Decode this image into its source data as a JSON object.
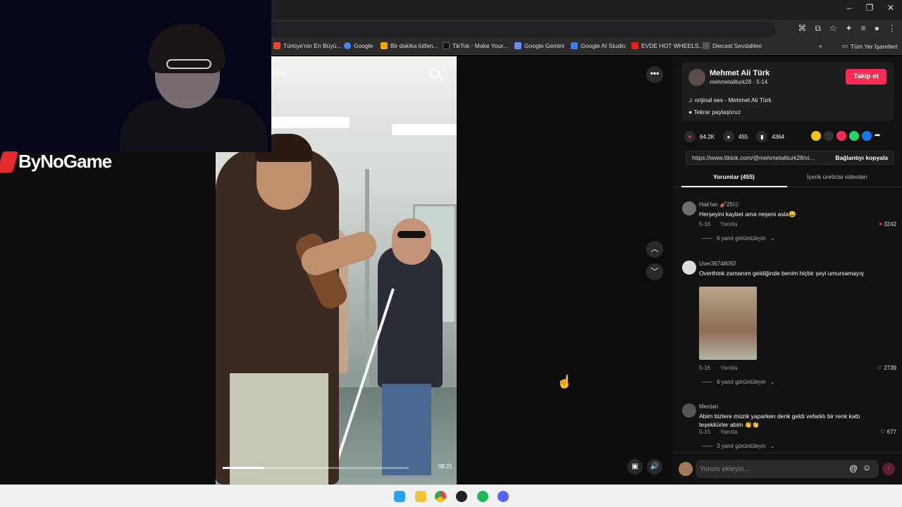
{
  "window": {
    "minimize": "–",
    "maximize": "❐",
    "close": "✕"
  },
  "bookmarks": [
    {
      "label": "Türkiye'nin En Büyü...",
      "color": "#e14a2b"
    },
    {
      "label": "Google",
      "color": "#4285f4"
    },
    {
      "label": "Bir dakika lütfen...",
      "color": "#f0a800"
    },
    {
      "label": "TikTok - Make Your...",
      "color": "#111111"
    },
    {
      "label": "Google Gemini",
      "color": "#6b8cf2"
    },
    {
      "label": "Google AI Studio",
      "color": "#3b7ded"
    },
    {
      "label": "EVDE HOT WHEELS...",
      "color": "#e62117"
    },
    {
      "label": "Diecast Sevdalileri",
      "color": "#555555"
    }
  ],
  "bookmarks_overflow": "»",
  "all_bookmarks": "Tüm Yer İşaretleri",
  "video": {
    "search_placeholder": "ulun",
    "timecode": "08:21",
    "progress": 0.22
  },
  "streamer": {
    "logo_text": "ByNoGame"
  },
  "author": {
    "name": "Mehmet Ali Türk",
    "handle": "mehmetaliturk28 · 5-14",
    "follow_label": "Takip et",
    "music": "orijinal ses - Mehmet Ali Türk",
    "repost": "Tekrar paylaştınız"
  },
  "stats": {
    "likes": "64.2K",
    "comments": "455",
    "saves": "4364"
  },
  "link": {
    "url": "https://www.tiktok.com/@mehmetaliturk28/vi...",
    "copy_label": "Bağlantıyı kopyala"
  },
  "tabs": {
    "comments": "Yorumlar (455)",
    "creator_videos": "İçerik üreticisi videoları"
  },
  "comments": [
    {
      "user": "Hak'tan 🎻25🎼",
      "text": "Herşeyini kaybet ama neşeni asla😄",
      "date": "5-16",
      "reply": "Yanıtla",
      "likes": "3242",
      "view_replies": "6 yanıt görüntüleyin"
    },
    {
      "user": "User36748092",
      "text": "Overthink zamanım geldiğinde benim hiçbir şeyi umursamayış",
      "date": "5-16",
      "reply": "Yanıtla",
      "likes": "2739",
      "view_replies": "6 yanıt görüntüleyin"
    },
    {
      "user": "Merdan",
      "text": "Abim bizlere müzik yaparken denk geldi vefarklı bir renk kattı teşekkürler abim 👏👏",
      "date": "5-15",
      "reply": "Yanıtla",
      "likes": "677",
      "view_replies": "3 yanıt görüntüleyin"
    }
  ],
  "comment_input": {
    "placeholder": "Yorum ekleyin..."
  },
  "icons": {
    "more": "•••",
    "up": "︿",
    "down": "﹀",
    "heart": "♥",
    "comment": "💬",
    "bookmark": "🔖",
    "at": "@",
    "emoji": "☺",
    "send": "↑",
    "volume": "🔊",
    "cursor": "☝"
  },
  "colors": {
    "accent": "#fe2c55",
    "panel_bg": "#121212"
  }
}
